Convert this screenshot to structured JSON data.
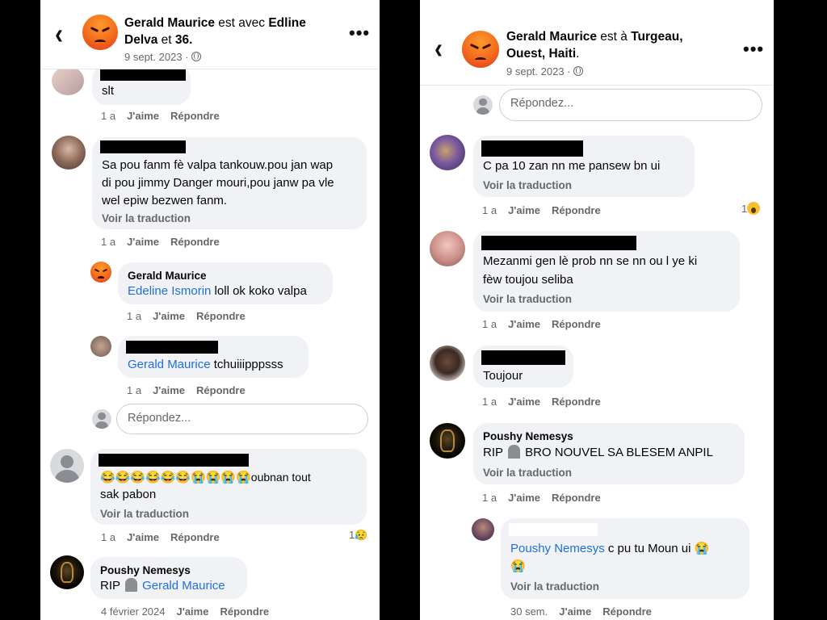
{
  "left_panel": {
    "header": {
      "author": "Gerald Maurice",
      "connector": " est avec ",
      "tagged": "Edline",
      "tagged_line2": "Delva",
      "and_text": " et ",
      "others": "36.",
      "date": "9 sept. 2023 ·"
    },
    "comments": [
      {
        "text": "slt",
        "time": "1 a",
        "like": "J'aime",
        "reply": "Répondre"
      },
      {
        "lines": [
          "Sa pou fanm fè valpa tankouw.pou jan wap",
          "di pou jimmy Danger mouri,pou janw pa vle",
          "wel epiw bezwen fanm."
        ],
        "translate": "Voir la traduction",
        "time": "1 a",
        "like": "J'aime",
        "reply": "Répondre"
      },
      {
        "name": "Gerald Maurice",
        "mention": "Edeline Ismorin",
        "text": " loll ok koko valpa",
        "time": "1 a",
        "like": "J'aime",
        "reply": "Répondre"
      },
      {
        "mention": "Gerald Maurice",
        "text": " tchuiiipppsss",
        "time": "1 a",
        "like": "J'aime",
        "reply": "Répondre"
      },
      {
        "emoji_row": "😂😂😂😂😂😂😭😭😭😭",
        "text_tail": "oubnan tout",
        "line2": "sak pabon",
        "translate": "Voir la traduction",
        "time": "1 a",
        "like": "J'aime",
        "reply": "Répondre",
        "reaction_count": "1",
        "reaction_emoji": "😥"
      },
      {
        "name": "Poushy Nemesys",
        "prefix": "RIP",
        "mention": "Gerald Maurice",
        "time": "4 février 2024",
        "like": "J'aime",
        "reply": "Répondre"
      }
    ],
    "reply_placeholder": "Répondez..."
  },
  "right_panel": {
    "header": {
      "author": "Gerald Maurice",
      "connector": " est à ",
      "place": "Turgeau,",
      "place_line2": "Ouest, Haiti",
      "dot": ".",
      "date": "9 sept. 2023 ·"
    },
    "reply_placeholder": "Répondez...",
    "comments": [
      {
        "text": "C pa 10 zan nn me pansew bn ui",
        "translate": "Voir la traduction",
        "time": "1 a",
        "like": "J'aime",
        "reply": "Répondre",
        "reaction_count": "1"
      },
      {
        "lines": [
          "Mezanmi gen lè prob nn se nn ou l ye ki",
          "fèw toujou seliba"
        ],
        "translate": "Voir la traduction",
        "time": "1 a",
        "like": "J'aime",
        "reply": "Répondre"
      },
      {
        "text": "Toujour",
        "time": "1 a",
        "like": "J'aime",
        "reply": "Répondre"
      },
      {
        "name": "Poushy Nemesys",
        "prefix": "RIP",
        "text": " BRO NOUVEL SA BLESEM ANPIL",
        "translate": "Voir la traduction",
        "time": "1 a",
        "like": "J'aime",
        "reply": "Répondre"
      },
      {
        "mention": "Poushy Nemesys",
        "text": " c pu tu Moun ui 😭",
        "line2": "😭",
        "translate": "Voir la traduction",
        "time": "30 sem.",
        "like": "J'aime",
        "reply": "Répondre"
      }
    ]
  },
  "icons": {
    "back": "chevron-left-icon",
    "more": "more-horizontal-icon",
    "audience": "globe-icon",
    "avatar_emoji": "angry-face-emoji"
  },
  "colors": {
    "bubble": "#f0f2f5",
    "link": "#216fdb",
    "meta": "#65676b",
    "background": "#000000"
  }
}
